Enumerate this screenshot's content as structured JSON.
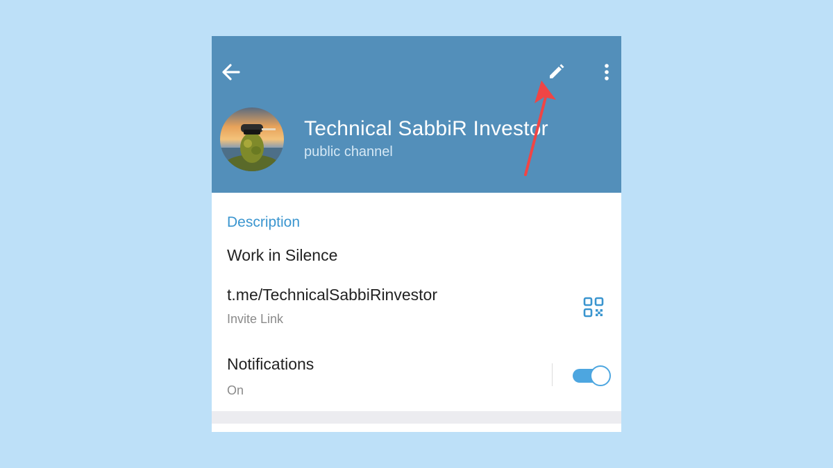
{
  "header": {
    "channel_name": "Technical SabbiR Investor",
    "channel_type": "public channel",
    "background_color": "#538fba",
    "back_icon": "arrow-left-icon",
    "edit_icon": "pencil-icon",
    "more_icon": "more-vertical-icon"
  },
  "info": {
    "description_title": "Description",
    "description_text": "Work in Silence",
    "link_text": "t.me/TechnicalSabbiRinvestor",
    "link_caption": "Invite Link",
    "qr_icon": "qr-code-icon",
    "notifications_title": "Notifications",
    "notifications_status": "On",
    "notifications_enabled": true,
    "accent_color": "#3a95cf"
  },
  "annotation": {
    "arrow_color": "#f04545"
  }
}
